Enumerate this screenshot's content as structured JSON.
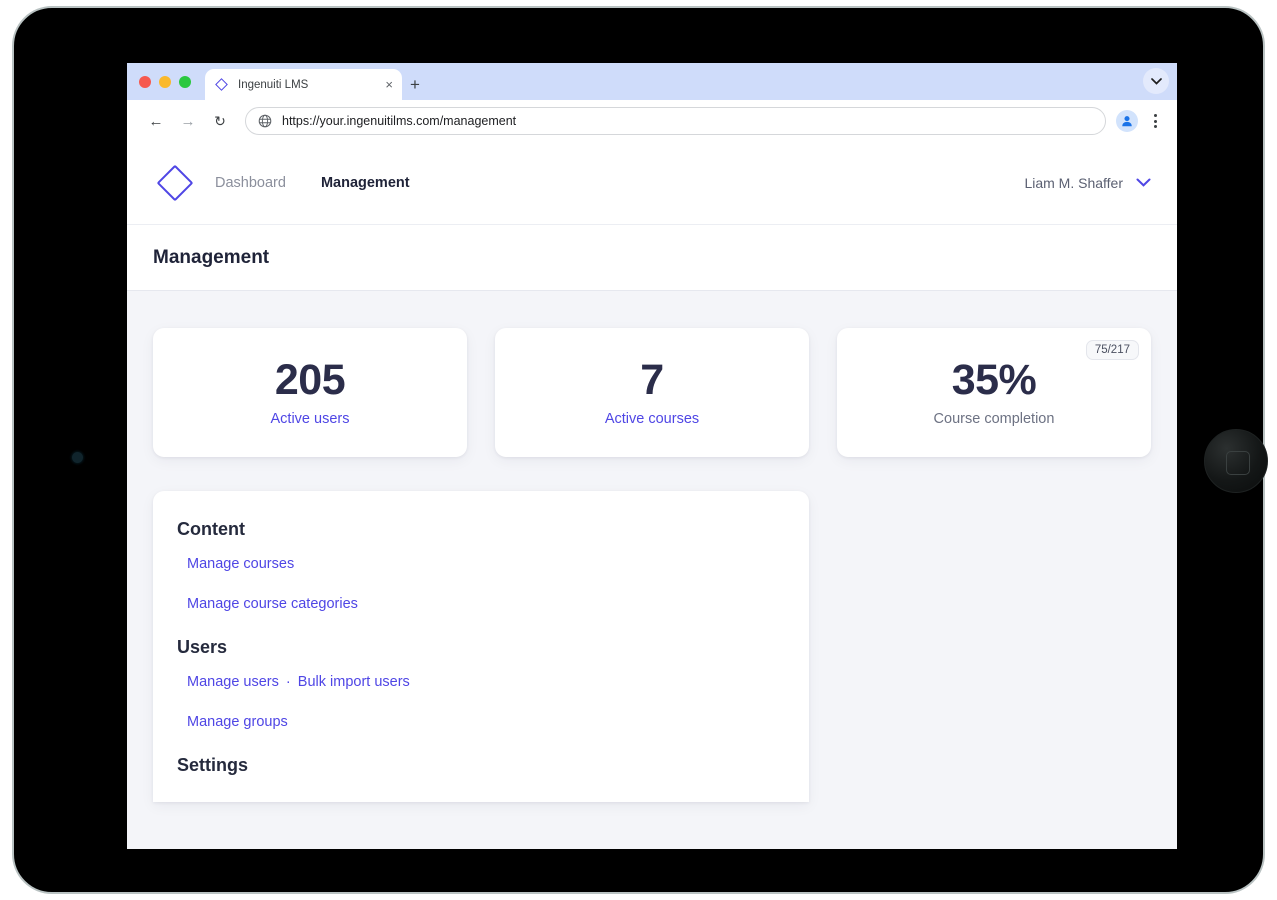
{
  "browser": {
    "traffic_lights": [
      "close",
      "minimize",
      "maximize"
    ],
    "tab": {
      "favicon": "diamond-logo-icon",
      "title": "Ingenuiti LMS",
      "close_label": "×"
    },
    "new_tab_label": "+",
    "tab_list_label": "⌄",
    "back_label": "←",
    "forward_label": "→",
    "reload_label": "↻",
    "omnibox": {
      "site_icon": "globe-icon",
      "url": "https://your.ingenuitilms.com/management"
    },
    "profile_icon": "person-avatar-icon",
    "menu_icon": "three-dot-menu-icon"
  },
  "app": {
    "logo_icon": "diamond-logo-icon",
    "nav_links": [
      {
        "label": "Dashboard",
        "active": false
      },
      {
        "label": "Management",
        "active": true
      }
    ],
    "user_menu": {
      "name": "Liam M. Shaffer",
      "chevron": "⌄"
    },
    "page_title": "Management"
  },
  "stat_cards": [
    {
      "value": "205",
      "label": "Active users",
      "label_is_link": true,
      "badge": null
    },
    {
      "value": "7",
      "label": "Active courses",
      "label_is_link": true,
      "badge": null
    },
    {
      "value": "35%",
      "label": "Course completion",
      "label_is_link": false,
      "badge": "75/217"
    }
  ],
  "management_sections": [
    {
      "heading": "Content",
      "rows": [
        {
          "links": [
            "Manage courses"
          ]
        },
        {
          "links": [
            "Manage course categories"
          ]
        }
      ]
    },
    {
      "heading": "Users",
      "rows": [
        {
          "links": [
            "Manage users",
            "Bulk import users"
          ]
        },
        {
          "links": [
            "Manage groups"
          ]
        }
      ]
    },
    {
      "heading": "Settings",
      "rows": []
    }
  ],
  "link_separator": "·",
  "colors": {
    "accent": "#4f46e5",
    "value_text": "#2b2d4a",
    "page_bg": "#f4f5f9",
    "card_bg": "#ffffff",
    "muted_text": "#6d7283"
  }
}
